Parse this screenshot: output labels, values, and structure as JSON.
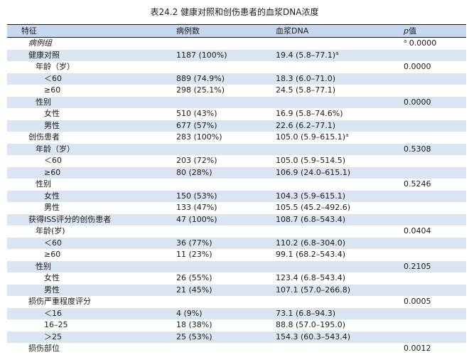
{
  "caption": "表24.2 健康对照和创伤患者的血浆DNA浓度",
  "headers": {
    "feature": "特征",
    "count": "病例数",
    "dna": "血浆DNA",
    "p_prefix": "p",
    "p_suffix": "值"
  },
  "rows": [
    {
      "label": "病例组",
      "count": "",
      "dna": "",
      "dna_sup": "",
      "p": "0.0000",
      "p_sup": "a"
    },
    {
      "label": "健康对照",
      "count": "1187 (100%)",
      "dna": "19.4 (5.8–77.1)",
      "dna_sup": "a",
      "p": "",
      "p_sup": ""
    },
    {
      "label": "年龄（岁）",
      "count": "",
      "dna": "",
      "dna_sup": "",
      "p": "0.0000",
      "p_sup": ""
    },
    {
      "label": "＜60",
      "count": "889 (74.9%)",
      "dna": "18.3 (6.0–71.0)",
      "dna_sup": "",
      "p": "",
      "p_sup": ""
    },
    {
      "label": "≥60",
      "count": "298 (25.1%)",
      "dna": "24.5 (5.8–77.1)",
      "dna_sup": "",
      "p": "",
      "p_sup": ""
    },
    {
      "label": "性别",
      "count": "",
      "dna": "",
      "dna_sup": "",
      "p": "0.0000",
      "p_sup": ""
    },
    {
      "label": "女性",
      "count": "510 (43%)",
      "dna": "16.9 (5.8–74.6%)",
      "dna_sup": "",
      "p": "",
      "p_sup": ""
    },
    {
      "label": "男性",
      "count": "677 (57%)",
      "dna": "22.6 (6.2–77.1)",
      "dna_sup": "",
      "p": "",
      "p_sup": ""
    },
    {
      "label": "创伤患者",
      "count": "283 (100%)",
      "dna": "105.0 (5.9–615.1)",
      "dna_sup": "a",
      "p": "",
      "p_sup": ""
    },
    {
      "label": "年龄（岁）",
      "count": "",
      "dna": "",
      "dna_sup": "",
      "p": "0.5308",
      "p_sup": ""
    },
    {
      "label": "＜60",
      "count": "203 (72%)",
      "dna": "105.0 (5.9–514.5)",
      "dna_sup": "",
      "p": "",
      "p_sup": ""
    },
    {
      "label": "≥60",
      "count": "80 (28%)",
      "dna": "106.9 (24.0–615.1)",
      "dna_sup": "",
      "p": "",
      "p_sup": ""
    },
    {
      "label": "性别",
      "count": "",
      "dna": "",
      "dna_sup": "",
      "p": "0.5246",
      "p_sup": ""
    },
    {
      "label": "女性",
      "count": "150 (53%)",
      "dna": "104.3 (5.9–615.1)",
      "dna_sup": "",
      "p": "",
      "p_sup": ""
    },
    {
      "label": "男性",
      "count": "133 (47%)",
      "dna": "105.5 (45.2–492.6)",
      "dna_sup": "",
      "p": "",
      "p_sup": ""
    },
    {
      "label": "获得ISS评分的创伤患者",
      "count": "47 (100%)",
      "dna": "108.7 (6.8–543.4)",
      "dna_sup": "",
      "p": "",
      "p_sup": ""
    },
    {
      "label": "年龄(岁)",
      "count": "",
      "dna": "",
      "dna_sup": "",
      "p": "0.0404",
      "p_sup": ""
    },
    {
      "label": "＜60",
      "count": "36 (77%)",
      "dna": "110.2 (6.8–304.0)",
      "dna_sup": "",
      "p": "",
      "p_sup": ""
    },
    {
      "label": "≥60",
      "count": "11 (23%)",
      "dna": "99.1 (68.2–543.4)",
      "dna_sup": "",
      "p": "",
      "p_sup": ""
    },
    {
      "label": "性别",
      "count": "",
      "dna": "",
      "dna_sup": "",
      "p": "0.2105",
      "p_sup": ""
    },
    {
      "label": "女性",
      "count": "26 (55%)",
      "dna": "123.4 (6.8–543.4)",
      "dna_sup": "",
      "p": "",
      "p_sup": ""
    },
    {
      "label": "男性",
      "count": "21 (45%)",
      "dna": "107.1 (57.0–266.8)",
      "dna_sup": "",
      "p": "",
      "p_sup": ""
    },
    {
      "label": "损伤严重程度评分",
      "count": "",
      "dna": "",
      "dna_sup": "",
      "p": "0.0005",
      "p_sup": ""
    },
    {
      "label": "＜16",
      "count": "4 (9%)",
      "dna": "73.1 (6.8–94.3)",
      "dna_sup": "",
      "p": "",
      "p_sup": ""
    },
    {
      "label": "16–25",
      "count": "18 (38%)",
      "dna": "88.8 (57.0–195.0)",
      "dna_sup": "",
      "p": "",
      "p_sup": ""
    },
    {
      "label": "＞25",
      "count": "25 (53%)",
      "dna": "154.3 (60.3–543.4)",
      "dna_sup": "",
      "p": "",
      "p_sup": ""
    },
    {
      "label": "损伤部位",
      "count": "",
      "dna": "",
      "dna_sup": "",
      "p": "0.0012",
      "p_sup": ""
    }
  ]
}
